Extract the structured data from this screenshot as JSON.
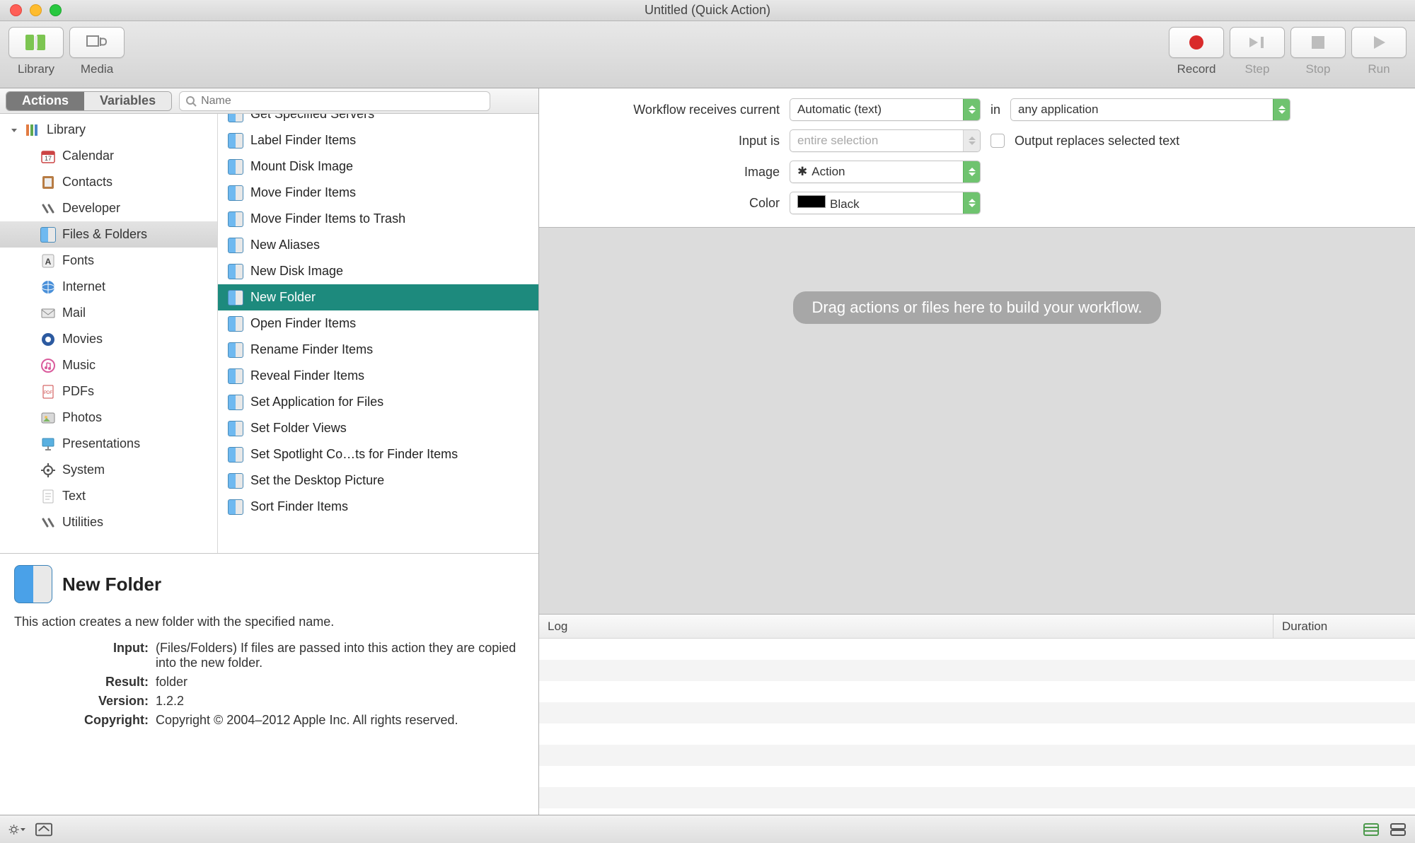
{
  "window": {
    "title": "Untitled (Quick Action)"
  },
  "toolbar": {
    "library": "Library",
    "media": "Media",
    "record": "Record",
    "step": "Step",
    "stop": "Stop",
    "run": "Run"
  },
  "tabs": {
    "actions": "Actions",
    "variables": "Variables"
  },
  "search": {
    "placeholder": "Name"
  },
  "library": {
    "root": "Library",
    "items": [
      "Calendar",
      "Contacts",
      "Developer",
      "Files & Folders",
      "Fonts",
      "Internet",
      "Mail",
      "Movies",
      "Music",
      "PDFs",
      "Photos",
      "Presentations",
      "System",
      "Text",
      "Utilities"
    ],
    "selected_index": 3
  },
  "actions": {
    "items": [
      "Get Specified Servers",
      "Label Finder Items",
      "Mount Disk Image",
      "Move Finder Items",
      "Move Finder Items to Trash",
      "New Aliases",
      "New Disk Image",
      "New Folder",
      "Open Finder Items",
      "Rename Finder Items",
      "Reveal Finder Items",
      "Set Application for Files",
      "Set Folder Views",
      "Set Spotlight Co…ts for Finder Items",
      "Set the Desktop Picture",
      "Sort Finder Items"
    ],
    "selected_index": 7
  },
  "info": {
    "title": "New Folder",
    "desc": "This action creates a new folder with the specified name.",
    "input_label": "Input:",
    "input_text": "(Files/Folders) If files are passed into this action they are copied into the new folder.",
    "result_label": "Result:",
    "result_text": "folder",
    "version_label": "Version:",
    "version_text": "1.2.2",
    "copyright_label": "Copyright:",
    "copyright_text": "Copyright © 2004–2012 Apple Inc.  All rights reserved."
  },
  "config": {
    "receives_label": "Workflow receives current",
    "receives_value": "Automatic (text)",
    "in_label": "in",
    "in_value": "any application",
    "input_is_label": "Input is",
    "input_is_value": "entire selection",
    "output_replaces": "Output replaces selected text",
    "image_label": "Image",
    "image_value": "Action",
    "color_label": "Color",
    "color_value": "Black"
  },
  "dropzone": {
    "text": "Drag actions or files here to build your workflow."
  },
  "log": {
    "col_log": "Log",
    "col_duration": "Duration"
  }
}
